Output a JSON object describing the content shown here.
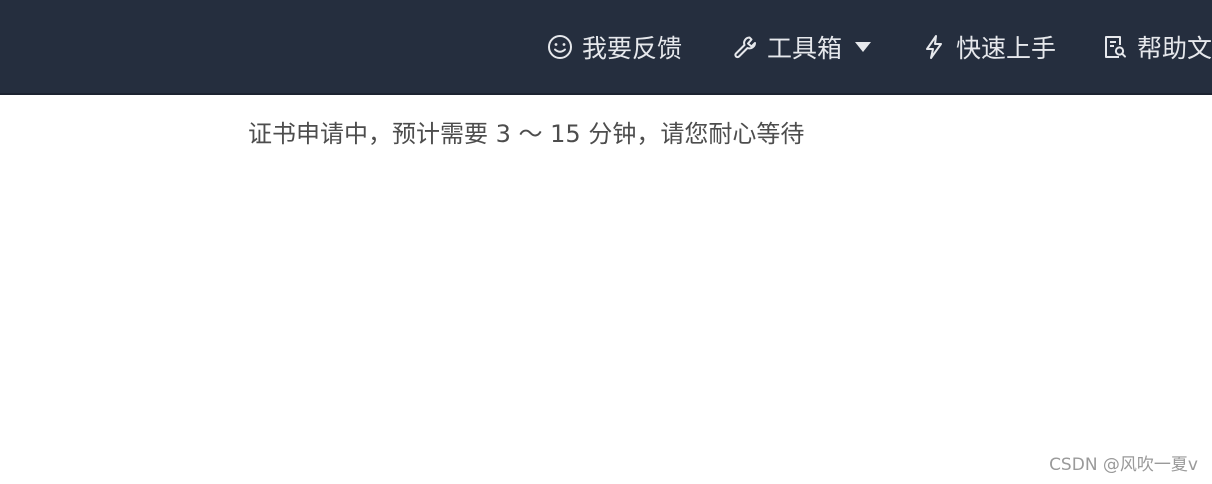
{
  "header": {
    "nav": {
      "feedback": {
        "label": "我要反馈",
        "icon": "smiley-icon"
      },
      "toolbox": {
        "label": "工具箱",
        "icon": "wrench-icon",
        "dropdown_icon": "caret-down-icon"
      },
      "quick_start": {
        "label": "快速上手",
        "icon": "lightning-icon"
      },
      "help": {
        "label": "帮助文",
        "icon": "document-search-icon"
      }
    },
    "colors": {
      "background": "#252e3e",
      "text": "#e6e8ec"
    }
  },
  "main": {
    "status_message": "证书申请中，预计需要 3 ～ 15 分钟，请您耐心等待"
  },
  "watermark": "CSDN @风吹一夏v"
}
